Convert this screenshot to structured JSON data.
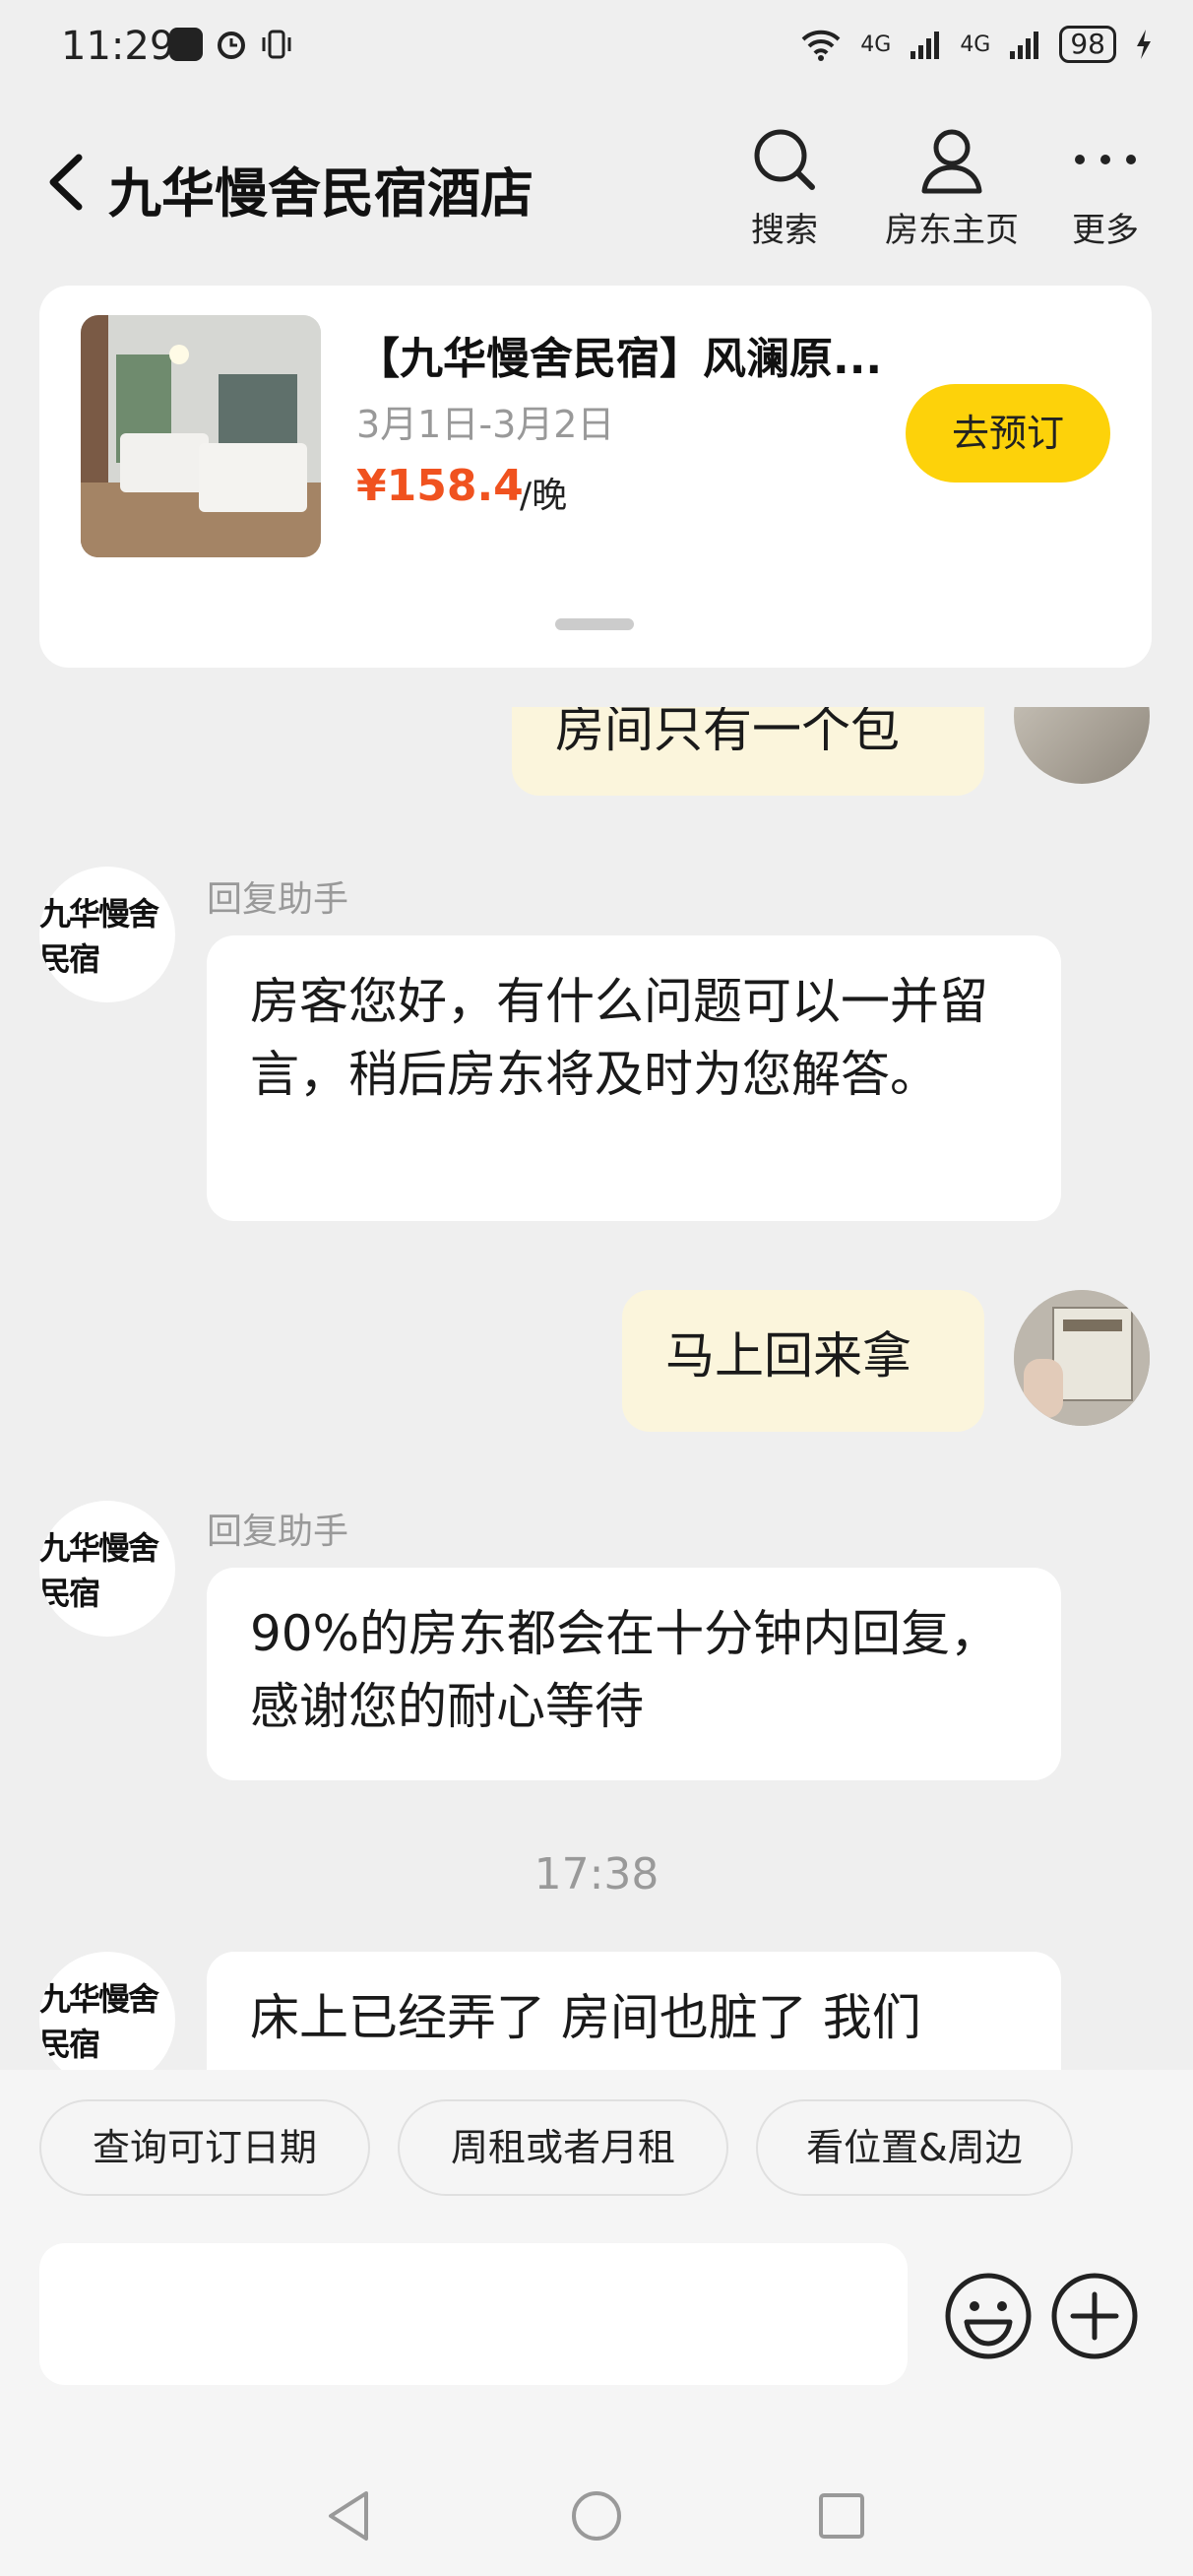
{
  "status_bar": {
    "time": "11:29",
    "signal_1": "4G",
    "signal_2": "4G",
    "battery": "98"
  },
  "header": {
    "title": "九华慢舍民宿酒店",
    "actions": [
      {
        "label": "搜索",
        "icon": "search-icon"
      },
      {
        "label": "房东主页",
        "icon": "person-icon"
      },
      {
        "label": "更多",
        "icon": "more-icon"
      }
    ]
  },
  "card": {
    "title": "【九华慢舍民宿】风澜原...",
    "dates": "3月1日-3月2日",
    "price": "¥158.4",
    "unit": "/晚",
    "book_label": "去预订"
  },
  "chat": {
    "messages": [
      {
        "from": "user",
        "text": "房间只有一个包"
      },
      {
        "from": "host",
        "sender": "回复助手",
        "text": "房客您好，有什么问题可以一并留言，稍后房东将及时为您解答。"
      },
      {
        "from": "user",
        "text": "马上回来拿"
      },
      {
        "from": "host",
        "sender": "回复助手",
        "text": "90%的房东都会在十分钟内回复， 感谢您的耐心等待"
      },
      {
        "from": "host",
        "text": "床上已经弄了 房间也脏了 我们"
      }
    ],
    "time_separator": "17:38",
    "host_logo_text": "九华慢舍民宿"
  },
  "quick_replies": [
    "查询可订日期",
    "周租或者月租",
    "看位置&周边"
  ],
  "colors": {
    "accent": "#fdd20a",
    "price": "#f0521f",
    "outgoing_bubble": "#fbf5dc",
    "background": "#efefef"
  }
}
